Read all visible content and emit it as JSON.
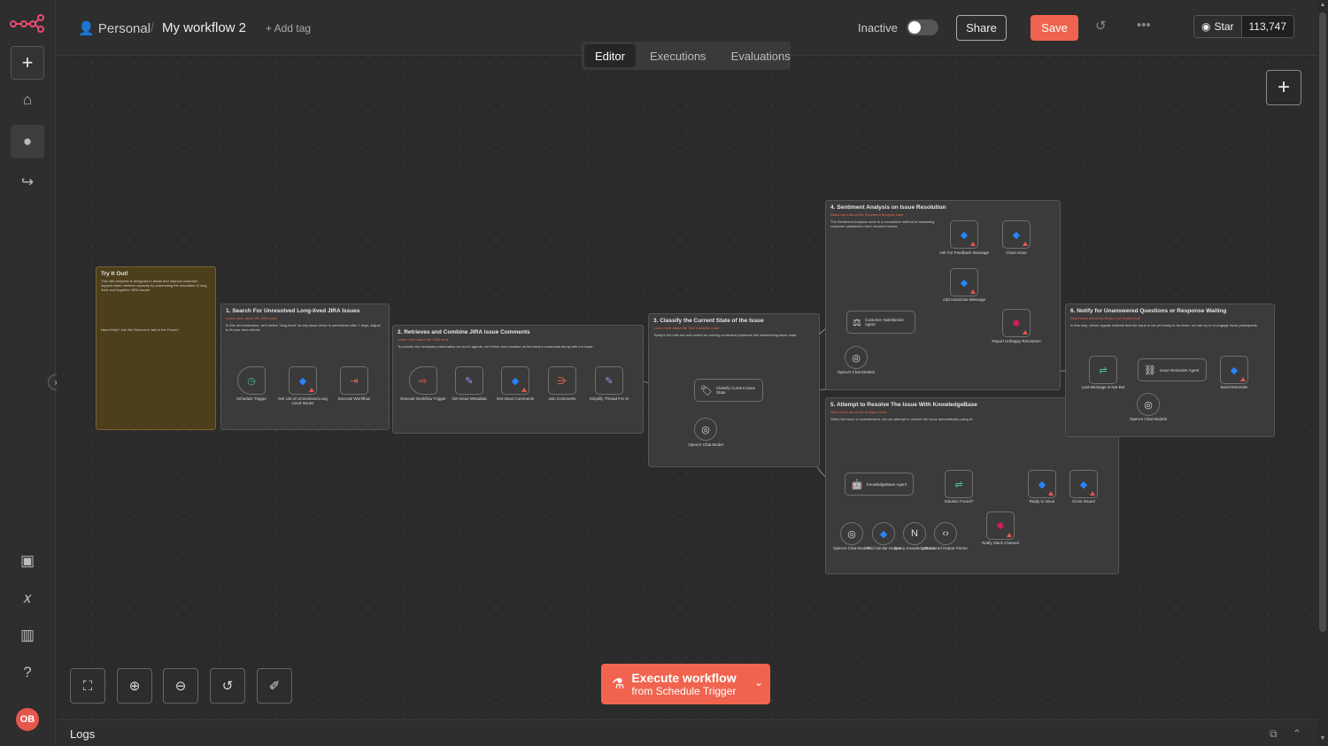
{
  "header": {
    "project": "Personal",
    "workflow_title": "My workflow 2",
    "add_tag": "+ Add tag",
    "status_label": "Inactive",
    "share": "Share",
    "save": "Save",
    "github_star": "Star",
    "github_count": "113,747"
  },
  "tabs": [
    {
      "label": "Editor",
      "active": true
    },
    {
      "label": "Executions",
      "active": false
    },
    {
      "label": "Evaluations",
      "active": false
    }
  ],
  "sidebar": {
    "avatar_initials": "OB",
    "items": [
      "home-icon",
      "user-icon",
      "share-icon",
      "templates-icon",
      "variables-icon",
      "insights-icon",
      "help-icon"
    ]
  },
  "stickies": {
    "intro": {
      "title": "Try It Out!",
      "body": "This n8n template is designed to assist and improve customer support team member capacity by automating the resolution of long-lived and forgotten JIRA issues.",
      "foot": "Need Help? Join the Discord or ask in the Forum!"
    },
    "s1": {
      "title": "1. Search For Unresolved Long-lived JIRA Issues",
      "link": "Learn more about the JIRA node",
      "body": "In this demonstration, we'll define \"long-lived\" as any issue which is unresolved after 7 days. Adjust to fit your own criteria."
    },
    "s2": {
      "title": "2. Retrieves and Combine JIRA Issue Comments",
      "link": "Learn more about the JIRA node",
      "body": "To provide the necessary information for our AI agents, we'll fetch and combine all the issue's comments along with our issue."
    },
    "s3": {
      "title": "3. Classify the Current State of the Issue",
      "link": "Learn more about the Text Classifier node",
      "body": "Today's AI/LLMs are well suited for solving contextual problems like determining issue state."
    },
    "s4": {
      "title": "4. Sentiment Analysis on Issue Resolution",
      "link": "Read more about the Sentiment Analysis node",
      "body": "The Sentiment Analysis node is a convenient method of assessing customer satisfaction from resolved issues."
    },
    "s5": {
      "title": "5. Attempt to Resolve The Issue With KnowledgeBase",
      "link": "Read more about the AI Agent node",
      "body": "When the issue is unaddressed, we can attempt to resolve the issue automatically using AI."
    },
    "s6": {
      "title": "6. Notify for Unanswered Questions or Response Waiting",
      "link": "Read more about the Basic LLM Chain node",
      "body": "In this step, where signals indicate that the issue is not yet ready to be close, we can try to re-engage issue participants."
    }
  },
  "nodes": {
    "schedule_trigger": "Schedule Trigger",
    "get_unresolved": "Get List of Unresolved Long Lived Issues",
    "execute_workflow": "Execute Workflow",
    "exec_trigger": "Execute Workflow Trigger",
    "get_metadata": "Get Issue Metadata",
    "get_comments": "Get Issue Comments",
    "join_comments": "Join Comments",
    "simplify_thread": "Simplify Thread For AI",
    "classify": "Classify Current Issue State",
    "openai_model": "OpenAI Chat Model",
    "customer_agent": "Customer Satisfaction Agent",
    "openai_model4": "OpenAI Chat Model4",
    "ask_feedback": "Ask For Feedback Message",
    "close_issue": "Close Issue",
    "add_autoclose": "Add Autoclose Message",
    "report_unhappy": "Report Unhappy Resolution",
    "last_message": "Last Message is Not Bot",
    "reminder_agent": "Issue Reminder Agent",
    "send_reminder": "Send Reminder",
    "openai_model3": "OpenAI Chat Model3",
    "kb_agent": "KnowledgeBase Agent",
    "solution_found": "Solution Found?",
    "reply_issue": "Reply to Issue",
    "close_issue2": "Close Issue2",
    "notify_slack": "Notify Slack Channel",
    "openai_model_kb": "OpenAI Chat Model5",
    "find_similar": "Find Similar Issues",
    "query_kb": "Query KnowledgeBase",
    "structured_parser": "Structured Output Parser"
  },
  "toolbar": {
    "execute_main": "Execute workflow",
    "execute_sub": "from Schedule Trigger"
  },
  "logs": {
    "label": "Logs"
  },
  "colors": {
    "accent": "#f0644f",
    "jira": "#2684ff",
    "warning": "#e5564d"
  }
}
